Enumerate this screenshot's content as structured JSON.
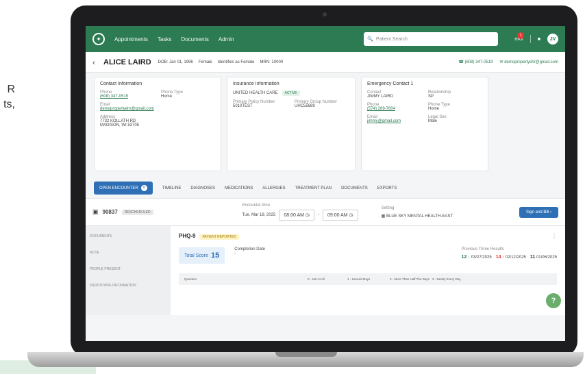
{
  "side_text": [
    "R",
    "ts,"
  ],
  "nav": {
    "links": [
      "Appointments",
      "Tasks",
      "Documents",
      "Admin"
    ],
    "search_placeholder": "Patient Search",
    "user_initials": "JV",
    "notif_count": "1",
    "notif_label": "nRx"
  },
  "patient": {
    "name": "ALICE LAIRD",
    "dob": "DOB: Jan 01, 1996",
    "sex": "Female",
    "identity": "Identifies as Female",
    "mrn": "MRN: 10000",
    "phone": "(608) 347-0519",
    "email": "demoproperlyehr@gmail.com"
  },
  "contact": {
    "title": "Contact Information",
    "phone_label": "Phone",
    "phone": "(608) 347-0519",
    "phone_type_label": "Phone Type",
    "phone_type": "Home",
    "email_label": "Email",
    "email": "demoproperlyehr@gmail.com",
    "address_label": "Address",
    "address1": "7732 KOLLATH RD",
    "address2": "MADISON, WI 53705"
  },
  "insurance": {
    "title": "Insurance Information",
    "company": "UNITED HEALTH CARE",
    "status": "ACTIVE",
    "policy_label": "Primary Policy Number",
    "policy": "5010TEST",
    "group_label": "Primary Group Number",
    "group": "UHC55689"
  },
  "emergency": {
    "title": "Emergency Contact 1",
    "contact_label": "Contact",
    "contact": "JIMMY LAIRD",
    "relationship_label": "Relationship",
    "relationship": "SP",
    "phone_label": "Phone",
    "phone": "(574) 289-7604",
    "phone_type_label": "Phone Type",
    "phone_type": "Home",
    "email_label": "Email",
    "email": "jimmy@gmail.com",
    "legal_sex_label": "Legal Sex",
    "legal_sex": "Male"
  },
  "tabs": [
    "OPEN ENCOUNTER",
    "TIMELINE",
    "DIAGNOSES",
    "MEDICATIONS",
    "ALLERGIES",
    "TREATMENT PLAN",
    "DOCUMENTS",
    "EXPORTS"
  ],
  "encounter": {
    "code": "90837",
    "status": "RESCHEDULED",
    "time_label": "Encounter time",
    "date": "Tue, Mar 18, 2025",
    "start": "08:00 AM",
    "end": "09:00 AM",
    "setting_label": "Setting",
    "setting": "BLUE SKY MENTAL HEALTH-EAST",
    "sign_button": "Sign and Bill"
  },
  "left_nav": [
    "DOCUMENTS",
    "NOTE",
    "PEOPLE PRESENT",
    "IDENTIFYING INFORMATION"
  ],
  "phq": {
    "title": "PHQ-9",
    "badge": "PATIENT REPORTED",
    "total_label": "Total Score",
    "total": "15",
    "completion_label": "Completion Date",
    "completion_value": "-",
    "prev_label": "Previous Three Results",
    "prev": [
      {
        "score": "12",
        "arrow": "↓",
        "date": "03/27/2025"
      },
      {
        "score": "14",
        "arrow": "↑",
        "date": "02/12/2025"
      },
      {
        "score": "11",
        "arrow": "",
        "date": "01/06/2025"
      }
    ],
    "columns": [
      "Question",
      "0 - Not At All",
      "1 - Several Days",
      "2 - More Than Half The Days",
      "3 - Nearly Every Day"
    ]
  },
  "colors": {
    "nav": "#2c7b53",
    "primary_blue": "#2e6fb5"
  }
}
